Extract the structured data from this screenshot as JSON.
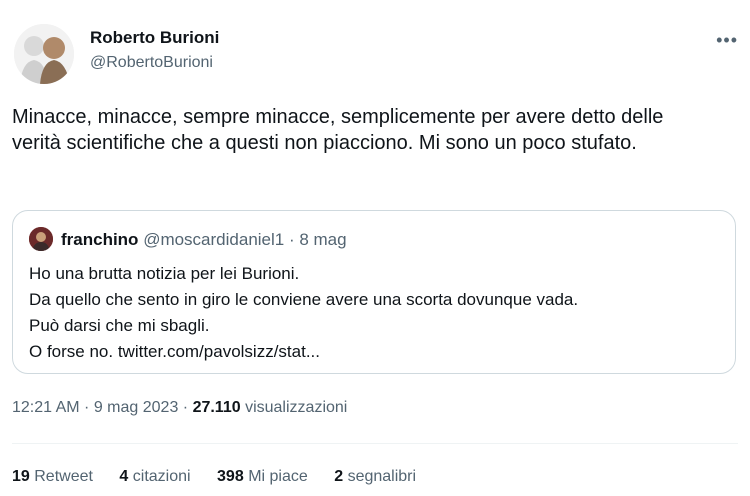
{
  "author": {
    "name": "Roberto Burioni",
    "handle": "@RobertoBurioni",
    "more_label": "•••"
  },
  "tweet": {
    "text": "Minacce, minacce, sempre minacce, semplicemente per avere detto delle verità scientifiche che a questi non piacciono. Mi sono un poco stufato."
  },
  "quote": {
    "name": "franchino",
    "handle": "@moscardidaniel1",
    "separator": " · ",
    "date": "8 mag",
    "lines": [
      "Ho una brutta notizia per lei Burioni.",
      "Da quello che sento in giro le conviene avere una scorta dovunque vada.",
      "Può darsi che mi sbagli.",
      "O forse no. twitter.com/pavolsizz/stat..."
    ]
  },
  "meta": {
    "time": "12:21 AM",
    "separator": " · ",
    "date": "9 mag 2023",
    "views_count": "27.110",
    "views_label": "visualizzazioni"
  },
  "stats": [
    {
      "count": "19",
      "label": "Retweet"
    },
    {
      "count": "4",
      "label": "citazioni"
    },
    {
      "count": "398",
      "label": "Mi piace"
    },
    {
      "count": "2",
      "label": "segnalibri"
    }
  ],
  "colors": {
    "text": "#0f1419",
    "secondary": "#536471",
    "border": "#cfd9de"
  }
}
